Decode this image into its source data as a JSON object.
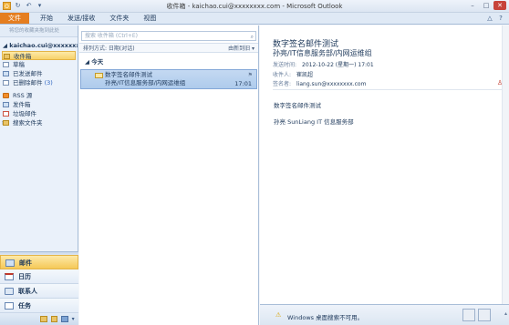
{
  "window": {
    "title": "收件箱 - kaichao.cui@xxxxxxxx.com - Microsoft Outlook",
    "min": "–",
    "max": "□",
    "close": "✕"
  },
  "qat": {
    "app": "O",
    "send_receive": "↻",
    "undo": "↶",
    "more": "▾"
  },
  "ribbon": {
    "tabs": [
      "文件",
      "开始",
      "发送/接收",
      "文件夹",
      "视图"
    ],
    "help": "?",
    "collapse": "△"
  },
  "nav": {
    "header": "将您的收藏夹拖到此处",
    "account": "kaichao.cui@xxxxxxxx.co",
    "folders": [
      {
        "label": "收件箱",
        "icon": "inbox-folder-icon",
        "selected": true
      },
      {
        "label": "草稿",
        "icon": "drafts-icon"
      },
      {
        "label": "已发送邮件",
        "icon": "sent-items-icon"
      },
      {
        "label": "已删除邮件",
        "count": "(3)",
        "icon": "deleted-items-icon"
      },
      {
        "label": "RSS 源",
        "icon": "rss-icon"
      },
      {
        "label": "发件箱",
        "icon": "outbox-icon"
      },
      {
        "label": "垃圾邮件",
        "icon": "junk-icon"
      },
      {
        "label": "搜索文件夹",
        "icon": "search-folder-icon"
      }
    ],
    "modules": [
      {
        "label": "邮件",
        "selected": true
      },
      {
        "label": "日历"
      },
      {
        "label": "联系人"
      },
      {
        "label": "任务"
      }
    ],
    "config_arrow": "▾"
  },
  "list": {
    "search_placeholder": "搜索 收件箱 (Ctrl+E)",
    "search_icon": "⌕",
    "arrange_by": "排列方式: 日期(对话)",
    "sort_order": "由新到旧 ▾",
    "group_label": "今天",
    "group_arrow": "◢",
    "messages": [
      {
        "subject": "数字签名邮件测试",
        "from": "孙亮/IT信息服务部/内网运维组",
        "time": "17:01",
        "flag": "⚑"
      }
    ]
  },
  "reading": {
    "subject": "数字签名邮件测试",
    "sender": "孙亮/IT信息服务部/内网运维组",
    "sent_label": "发送时间:",
    "sent_value": "2012-10-22 (星期一) 17:01",
    "to_label": "收件人:",
    "to_value": "崔凯超",
    "signed_label": "签名者:",
    "signed_value": "liang.sun@xxxxxxxx.com",
    "body_line1": "数字签名邮件测试",
    "body_line2": "孙亮 SunLiang IT 信息服务部",
    "cert_icon": "♙",
    "people_pane_text": "Windows 桌面搜索不可用。",
    "people_pane_warn": "⚠",
    "people_pane_collapse": "▴"
  }
}
